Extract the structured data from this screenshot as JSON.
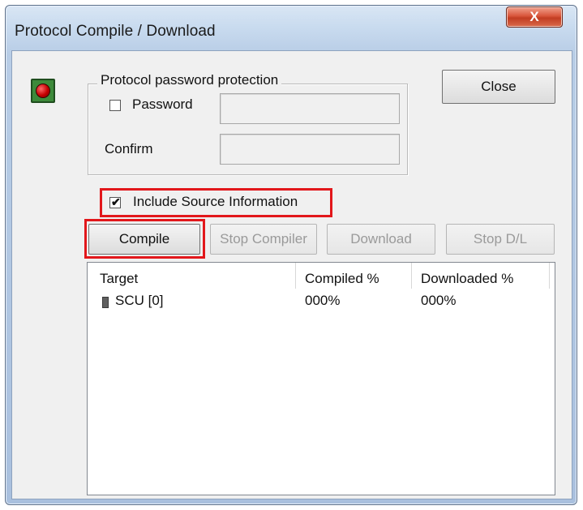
{
  "window": {
    "title": "Protocol Compile / Download",
    "close_glyph": "X"
  },
  "status_lamp": {
    "icon": "red-status-lamp-icon"
  },
  "password_group": {
    "legend": "Protocol password protection",
    "password_label": "Password",
    "password_checked": false,
    "password_value": "",
    "confirm_label": "Confirm",
    "confirm_value": ""
  },
  "include_source": {
    "label": "Include Source Information",
    "checked": true,
    "check_glyph": "✔"
  },
  "buttons": {
    "close": "Close",
    "compile": "Compile",
    "stop_compiler": "Stop Compiler",
    "download": "Download",
    "stop_dl": "Stop D/L"
  },
  "targets_table": {
    "columns": [
      "Target",
      "Compiled %",
      "Downloaded %"
    ],
    "rows": [
      {
        "target": "SCU [0]",
        "compiled": "000%",
        "downloaded": "000%",
        "icon": "device-icon"
      }
    ]
  },
  "highlight_color": "#e2171b"
}
